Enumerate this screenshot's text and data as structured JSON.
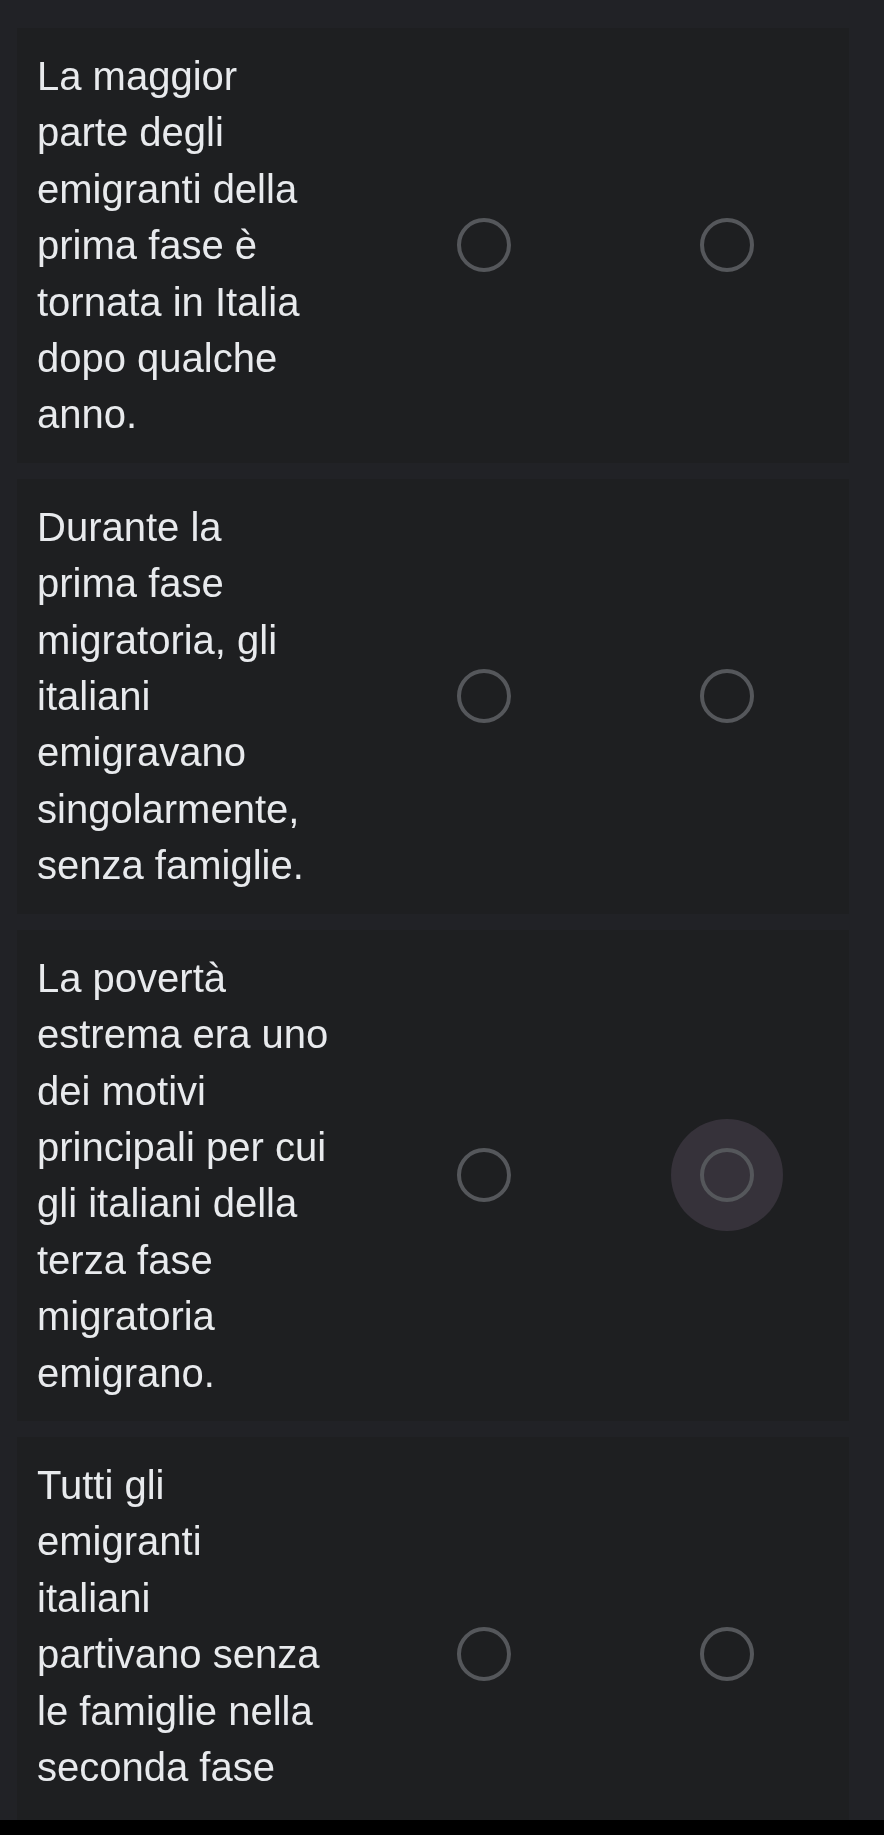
{
  "rows": [
    {
      "statement": "La maggior\nparte degli\nemigranti della\nprima fase è\ntornata in Italia\ndopo qualche\nanno.",
      "options": [
        {
          "selected": false,
          "focused": false
        },
        {
          "selected": false,
          "focused": false
        }
      ]
    },
    {
      "statement": "Durante la\nprima fase\nmigratoria, gli\nitaliani\nemigravano\nsingolarmente,\nsenza famiglie.",
      "options": [
        {
          "selected": false,
          "focused": false
        },
        {
          "selected": false,
          "focused": false
        }
      ]
    },
    {
      "statement": "La povertà\nestrema era uno\ndei motivi\nprincipali per cui\ngli italiani della\nterza fase\nmigratoria\nemigrano.",
      "options": [
        {
          "selected": false,
          "focused": false
        },
        {
          "selected": false,
          "focused": true
        }
      ]
    },
    {
      "statement": "Tutti gli\nemigranti\nitaliani\npartivano senza\nle famiglie nella\nseconda fase",
      "options": [
        {
          "selected": false,
          "focused": false
        },
        {
          "selected": false,
          "focused": false
        }
      ]
    }
  ]
}
